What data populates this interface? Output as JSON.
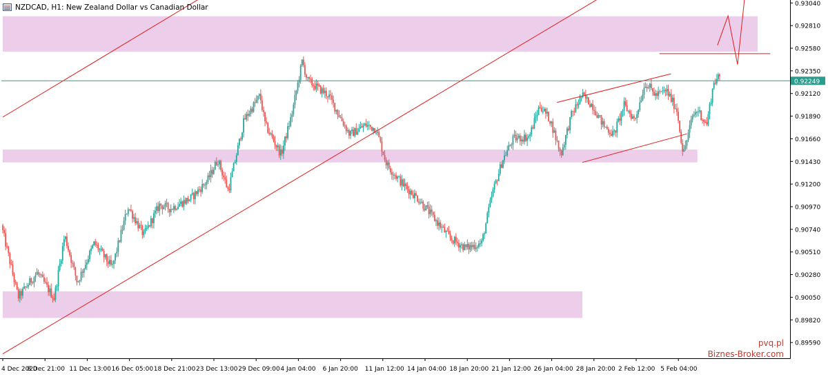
{
  "header": {
    "symbol": "NZDCAD",
    "timeframe": "H1",
    "title": "NZDCAD, H1:  New Zealand Dollar vs Canadian Dollar"
  },
  "watermark": {
    "line1": "pvq.pl",
    "line2": "Biznes-Broker.com"
  },
  "colors": {
    "background": "#ffffff",
    "bull_candle": "#26a69a",
    "bear_candle": "#ef5350",
    "zone_fill": "#eccdea",
    "trendline": "#e31b1b",
    "current_price_line": "#2a9d8f",
    "axis": "#000000",
    "watermark": "#c0392b"
  },
  "icons": {
    "symbol_icon": "chart-window-icon"
  },
  "chart_data": {
    "type": "candlestick",
    "ylim": [
      0.8943,
      0.9307
    ],
    "y_ticks": [
      "0.93040",
      "0.92810",
      "0.92580",
      "0.92350",
      "0.92120",
      "0.91890",
      "0.91660",
      "0.91430",
      "0.91200",
      "0.90970",
      "0.90740",
      "0.90510",
      "0.90280",
      "0.90050",
      "0.89820",
      "0.89590"
    ],
    "x_tick_labels": [
      "4 Dec 2020",
      "8 Dec 21:00",
      "11 Dec 13:00",
      "16 Dec 05:00",
      "18 Dec 21:00",
      "23 Dec 13:00",
      "29 Dec 09:00",
      "4 Jan 04:00",
      "6 Jan 20:00",
      "11 Jan 12:00",
      "14 Jan 04:00",
      "18 Jan 20:00",
      "21 Jan 12:00",
      "26 Jan 04:00",
      "28 Jan 20:00",
      "2 Feb 12:00",
      "5 Feb 04:00"
    ],
    "current_price": 0.92249,
    "current_price_label": "0.92249",
    "anchors": [
      [
        0,
        0.9078
      ],
      [
        1.6,
        0.9005
      ],
      [
        3.4,
        0.903
      ],
      [
        5.0,
        0.9004
      ],
      [
        6.0,
        0.9068
      ],
      [
        7.2,
        0.902
      ],
      [
        8.8,
        0.906
      ],
      [
        10.5,
        0.9035
      ],
      [
        12.0,
        0.9097
      ],
      [
        13.5,
        0.9068
      ],
      [
        15.0,
        0.9099
      ],
      [
        16.0,
        0.9095
      ],
      [
        18.0,
        0.9106
      ],
      [
        19.5,
        0.9123
      ],
      [
        20.5,
        0.9145
      ],
      [
        21.5,
        0.9113
      ],
      [
        23.0,
        0.9185
      ],
      [
        24.5,
        0.921
      ],
      [
        25.0,
        0.918
      ],
      [
        26.5,
        0.915
      ],
      [
        27.5,
        0.919
      ],
      [
        28.5,
        0.9245
      ],
      [
        29.0,
        0.9225
      ],
      [
        31.0,
        0.921
      ],
      [
        32.0,
        0.919
      ],
      [
        33.0,
        0.917
      ],
      [
        34.5,
        0.918
      ],
      [
        35.5,
        0.9176
      ],
      [
        36.5,
        0.914
      ],
      [
        38.0,
        0.912
      ],
      [
        39.5,
        0.9105
      ],
      [
        41.0,
        0.9085
      ],
      [
        42.5,
        0.9065
      ],
      [
        44.0,
        0.9055
      ],
      [
        45.5,
        0.906
      ],
      [
        46.5,
        0.911
      ],
      [
        47.5,
        0.9145
      ],
      [
        48.5,
        0.9166
      ],
      [
        50.0,
        0.9168
      ],
      [
        51.0,
        0.92
      ],
      [
        52.0,
        0.9185
      ],
      [
        53.0,
        0.915
      ],
      [
        54.0,
        0.919
      ],
      [
        55.0,
        0.921
      ],
      [
        56.0,
        0.92
      ],
      [
        57.0,
        0.918
      ],
      [
        58.0,
        0.917
      ],
      [
        59.0,
        0.92
      ],
      [
        60.0,
        0.9185
      ],
      [
        61.0,
        0.9223
      ],
      [
        62.0,
        0.921
      ],
      [
        63.0,
        0.9215
      ],
      [
        64.0,
        0.9195
      ],
      [
        64.6,
        0.915
      ],
      [
        65.5,
        0.919
      ],
      [
        66.0,
        0.9195
      ],
      [
        66.8,
        0.918
      ],
      [
        67.5,
        0.9224
      ],
      [
        68.0,
        0.9228
      ]
    ],
    "zones": [
      {
        "name": "resistance-zone",
        "x": [
          0,
          71.5
        ],
        "y": [
          0.92545,
          0.92905
        ]
      },
      {
        "name": "middle-zone",
        "x": [
          0,
          65.8
        ],
        "y": [
          0.9142,
          0.9155
        ]
      },
      {
        "name": "support-zone",
        "x": [
          0,
          54.9
        ],
        "y": [
          0.8984,
          0.9011
        ]
      }
    ],
    "trendlines": [
      {
        "name": "upper-channel-line",
        "points": [
          [
            0,
            0.9188
          ],
          [
            19.2,
            0.9312
          ]
        ]
      },
      {
        "name": "main-trendline",
        "points": [
          [
            0,
            0.89475
          ],
          [
            57.0,
            0.9312
          ]
        ]
      },
      {
        "name": "wedge-upper-line",
        "points": [
          [
            52.5,
            0.9203
          ],
          [
            63.3,
            0.9232
          ]
        ]
      },
      {
        "name": "wedge-lower-line",
        "points": [
          [
            54.9,
            0.9142
          ],
          [
            64.8,
            0.9171
          ]
        ]
      },
      {
        "name": "target-level-line",
        "points": [
          [
            62.2,
            0.92525
          ],
          [
            72.7,
            0.92525
          ]
        ]
      },
      {
        "name": "projection-path",
        "points": [
          [
            67.7,
            0.9261
          ],
          [
            68.7,
            0.9291
          ],
          [
            69.6,
            0.92415
          ],
          [
            70.3,
            0.9312
          ]
        ]
      }
    ]
  }
}
